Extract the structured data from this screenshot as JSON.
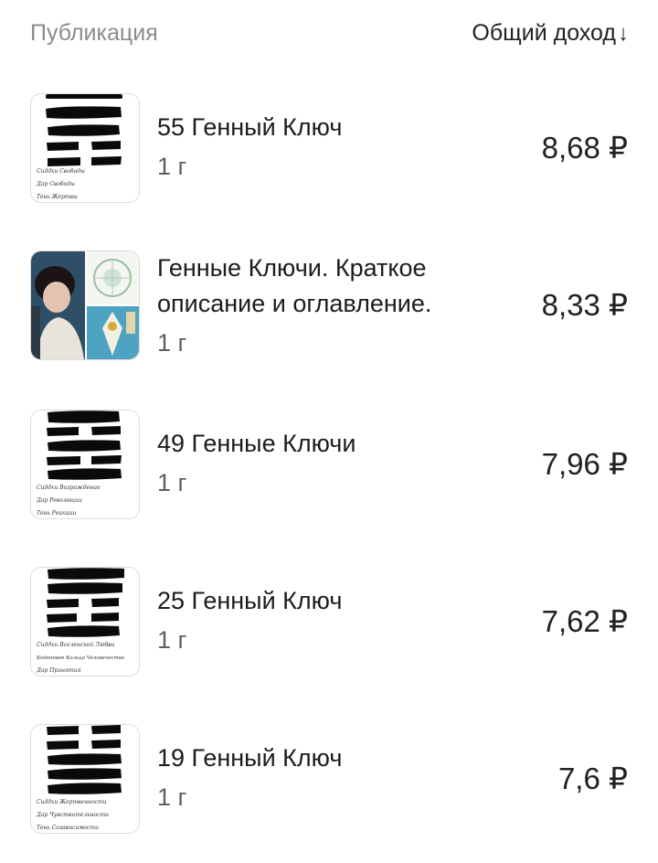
{
  "header": {
    "col_publication": "Публикация",
    "col_income": "Общий доход",
    "sort_icon": "arrow-down-icon"
  },
  "items": [
    {
      "title": "55 Генный Ключ",
      "meta": "1 г",
      "amount": "8,68 ₽",
      "thumb_lines": [
        "Сиддхи Свободы",
        "Дар Свободы",
        "Тень Жертвы"
      ]
    },
    {
      "title": "Генные Ключи. Краткое описание и оглавление.",
      "meta": "1 г",
      "amount": "8,33 ₽",
      "thumb_lines": []
    },
    {
      "title": "49 Генные Ключи",
      "meta": "1 г",
      "amount": "7,96 ₽",
      "thumb_lines": [
        "Сиддхи Возрождение",
        "Дар Революции",
        "Тень Реакции"
      ]
    },
    {
      "title": "25 Генный Ключ",
      "meta": "1 г",
      "amount": "7,62 ₽",
      "thumb_lines": [
        "Сиддхи Вселенской Любви",
        "Кодоновое Кольцо Человечества",
        "Дар Принятия"
      ]
    },
    {
      "title": "19 Генный Ключ",
      "meta": "1 г",
      "amount": "7,6 ₽",
      "thumb_lines": [
        "Сиддхи Жертвенности",
        "Дар Чувствительности",
        "Тень Созависимости"
      ]
    }
  ],
  "colors": {
    "header_label": "#8c8c8c",
    "text": "#1c1c1c",
    "meta": "#5f5f5f",
    "thumb_border": "#dcdcdc",
    "brush": "#0a0a0a"
  }
}
